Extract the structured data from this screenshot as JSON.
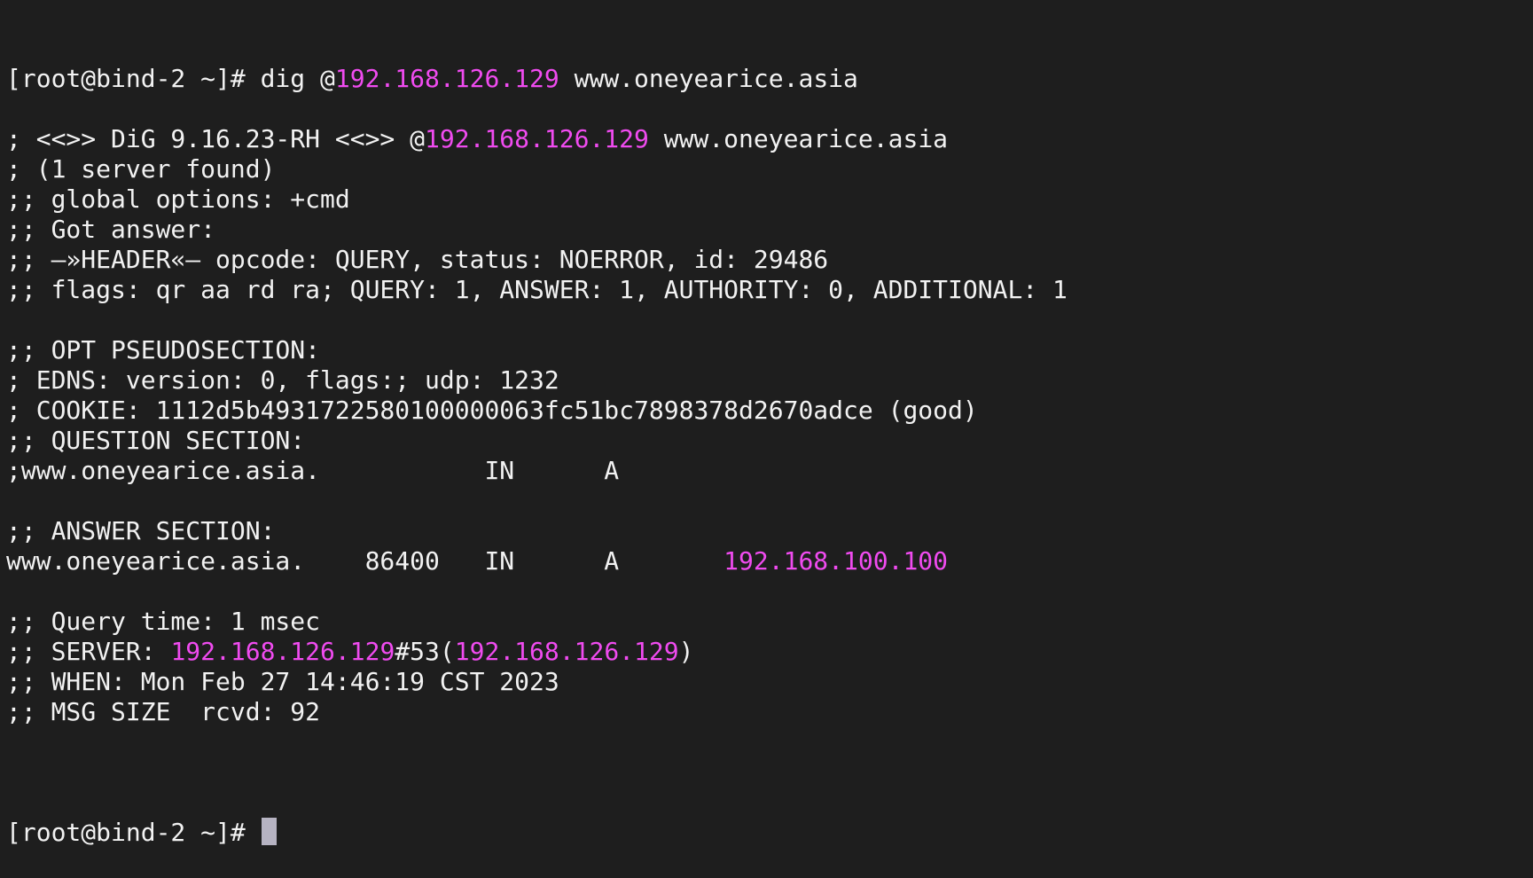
{
  "theme": {
    "background": "#1e1e1e",
    "foreground": "#f2f2f2",
    "highlight": "#f04bf0",
    "cursor": "#b6b3c2"
  },
  "terminal": {
    "lines": [
      [
        {
          "t": "[root@bind-2 ~]# dig @"
        },
        {
          "t": "192.168.126.129",
          "hl": true
        },
        {
          "t": " www.oneyearice.asia"
        }
      ],
      [],
      [
        {
          "t": "; <<>> DiG 9.16.23-RH <<>> @"
        },
        {
          "t": "192.168.126.129",
          "hl": true
        },
        {
          "t": " www.oneyearice.asia"
        }
      ],
      [
        {
          "t": "; (1 server found)"
        }
      ],
      [
        {
          "t": ";; global options: +cmd"
        }
      ],
      [
        {
          "t": ";; Got answer:"
        }
      ],
      [
        {
          "t": ";; —»HEADER«— opcode: QUERY, status: NOERROR, id: 29486"
        }
      ],
      [
        {
          "t": ";; flags: qr aa rd ra; QUERY: 1, ANSWER: 1, AUTHORITY: 0, ADDITIONAL: 1"
        }
      ],
      [],
      [
        {
          "t": ";; OPT PSEUDOSECTION:"
        }
      ],
      [
        {
          "t": "; EDNS: version: 0, flags:; udp: 1232"
        }
      ],
      [
        {
          "t": "; COOKIE: 1112d5b4931722580100000063fc51bc7898378d2670adce (good)"
        }
      ],
      [
        {
          "t": ";; QUESTION SECTION:"
        }
      ],
      [
        {
          "t": ";www.oneyearice.asia.           IN      A"
        }
      ],
      [],
      [
        {
          "t": ";; ANSWER SECTION:"
        }
      ],
      [
        {
          "t": "www.oneyearice.asia.    86400   IN      A       "
        },
        {
          "t": "192.168.100.100",
          "hl": true
        }
      ],
      [],
      [
        {
          "t": ";; Query time: 1 msec"
        }
      ],
      [
        {
          "t": ";; SERVER: "
        },
        {
          "t": "192.168.126.129",
          "hl": true
        },
        {
          "t": "#53("
        },
        {
          "t": "192.168.126.129",
          "hl": true
        },
        {
          "t": ")"
        }
      ],
      [
        {
          "t": ";; WHEN: Mon Feb 27 14:46:19 CST 2023"
        }
      ],
      [
        {
          "t": ";; MSG SIZE  rcvd: 92"
        }
      ],
      []
    ],
    "prompt": "[root@bind-2 ~]# "
  }
}
